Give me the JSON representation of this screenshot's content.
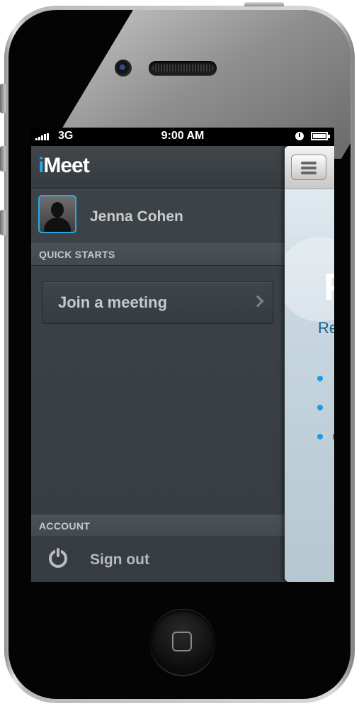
{
  "status_bar": {
    "carrier": "3G",
    "time": "9:00 AM"
  },
  "app": {
    "logo_prefix": "i",
    "logo_rest": "Meet"
  },
  "profile": {
    "name": "Jenna Cohen"
  },
  "sections": {
    "quick_starts": "QUICK STARTS",
    "account": "ACCOUNT"
  },
  "menu_items": {
    "join_meeting": "Join a meeting",
    "sign_out": "Sign out"
  },
  "content_peek": {
    "title_fragment": "F",
    "subtitle_fragment": "Re"
  },
  "colors": {
    "accent": "#25a8e6",
    "menu_background": "#3a4044"
  },
  "icons": [
    "signal-icon",
    "clock-icon",
    "battery-icon",
    "avatar-icon",
    "chevron-right-icon",
    "power-icon",
    "hamburger-menu-icon"
  ]
}
